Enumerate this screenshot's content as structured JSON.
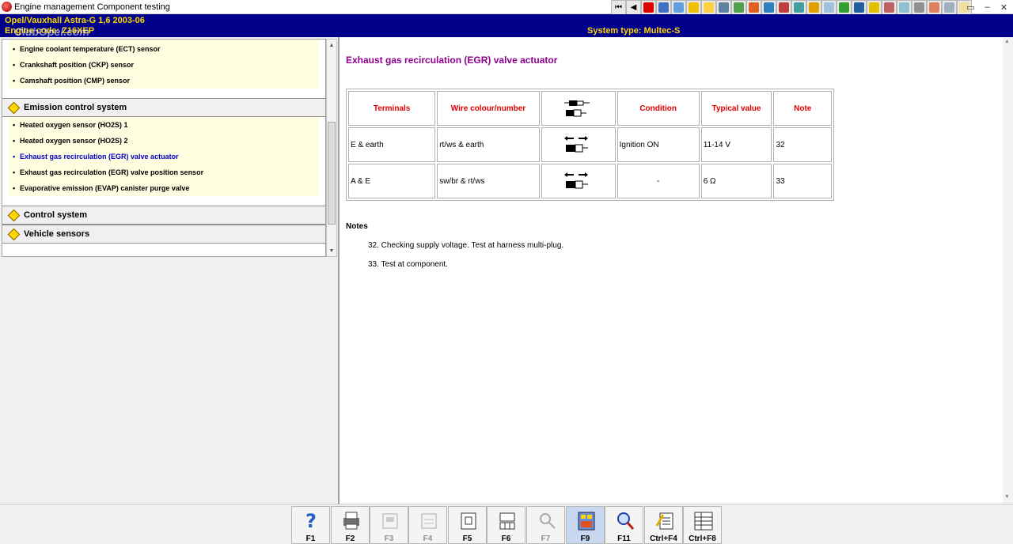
{
  "window": {
    "title": "Engine management Component testing"
  },
  "header": {
    "vehicle_line1": "Opel/Vauxhall   Astra-G  1,6  2003-06",
    "vehicle_line2": "Engine code: Z16XEP",
    "system_type": "System type: Multec-S",
    "watermark": "ClubOpel.com"
  },
  "tree": {
    "top_items": [
      "Engine coolant temperature (ECT) sensor",
      "Crankshaft position (CKP) sensor",
      "Camshaft position (CMP) sensor"
    ],
    "groups": {
      "emission": "Emission control system",
      "control": "Control system",
      "vehicle": "Vehicle sensors"
    },
    "emission_items": [
      "Heated oxygen sensor (HO2S) 1",
      "Heated oxygen sensor (HO2S) 2",
      "Exhaust gas recirculation (EGR) valve actuator",
      "Exhaust gas recirculation (EGR) valve position sensor",
      "Evaporative emission (EVAP) canister purge valve"
    ],
    "bullet": "•"
  },
  "content": {
    "heading": "Exhaust gas recirculation (EGR) valve actuator",
    "table": {
      "headers": [
        "Terminals",
        "Wire colour/number",
        "",
        "Condition",
        "Typical value",
        "Note"
      ],
      "rows": [
        {
          "terminals": "E & earth",
          "wire": "rt/ws & earth",
          "condition": "Ignition ON",
          "value": "11-14 V",
          "note": "32"
        },
        {
          "terminals": "A & E",
          "wire": "sw/br & rt/ws",
          "condition": "-",
          "value": "6 Ω",
          "note": "33"
        }
      ]
    },
    "notes_title": "Notes",
    "notes": [
      "32. Checking supply voltage. Test at harness multi-plug.",
      "33. Test at component."
    ]
  },
  "function_keys": [
    {
      "label": "F1",
      "icon": "help-icon",
      "enabled": true
    },
    {
      "label": "F2",
      "icon": "print-icon",
      "enabled": true
    },
    {
      "label": "F3",
      "icon": "connector-icon",
      "enabled": false
    },
    {
      "label": "F4",
      "icon": "connector-data-icon",
      "enabled": false
    },
    {
      "label": "F5",
      "icon": "component-location-icon",
      "enabled": true
    },
    {
      "label": "F6",
      "icon": "pin-data-icon",
      "enabled": true
    },
    {
      "label": "F7",
      "icon": "probe-icon",
      "enabled": false
    },
    {
      "label": "F9",
      "icon": "component-test-icon",
      "enabled": true
    },
    {
      "label": "F11",
      "icon": "search-icon",
      "enabled": true
    },
    {
      "label": "Ctrl+F4",
      "icon": "notes-icon",
      "enabled": true
    },
    {
      "label": "Ctrl+F8",
      "icon": "list-icon",
      "enabled": true
    }
  ],
  "colors": {
    "header_bg": "#00008b",
    "header_text": "#ffd700",
    "heading": "#8b008b",
    "table_header": "#dd0000",
    "active_item": "#0000cc"
  }
}
